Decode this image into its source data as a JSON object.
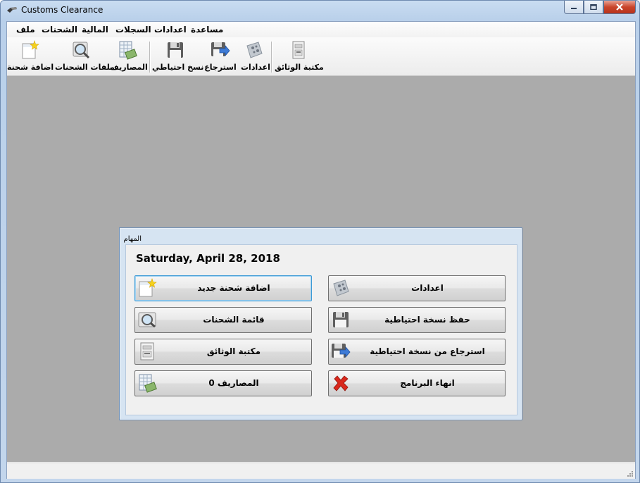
{
  "window": {
    "title": "Customs Clearance"
  },
  "menu": {
    "items": [
      "ملف",
      "الشحنات",
      "المالية",
      "السجلات",
      "اعدادات",
      "مساعدة"
    ]
  },
  "toolbar": {
    "buttons": [
      {
        "label": "اضافة شحنة",
        "icon": "new-document-star-icon"
      },
      {
        "label": "ملفات الشحنات",
        "icon": "magnifier-icon"
      },
      {
        "label": "المصاريف",
        "icon": "spreadsheet-money-icon"
      },
      {
        "label": "نسخ احتياطي",
        "icon": "floppy-disk-icon"
      },
      {
        "label": "استرجاع",
        "icon": "floppy-restore-icon"
      },
      {
        "label": "اعدادات",
        "icon": "settings-icon"
      },
      {
        "label": "مكتبة الوثائق",
        "icon": "document-library-icon"
      }
    ]
  },
  "tasks": {
    "title": "المهام",
    "date": "Saturday, April 28, 2018",
    "buttons": {
      "add_shipment": "اضافة شحنة جديد",
      "shipments_list": "قائمة الشحنات",
      "doc_library": "مكتبة الوثائق",
      "expenses": "المصاريف 0",
      "settings": "اعدادات",
      "backup": "حفظ نسخة احتياطية",
      "restore": "استرجاع من نسخة احتياطية",
      "exit": "انهاء البرنامج"
    }
  },
  "colors": {
    "mdi_background": "#ababab",
    "focus_border": "#3c9ad6",
    "exit_red": "#d9281c"
  }
}
